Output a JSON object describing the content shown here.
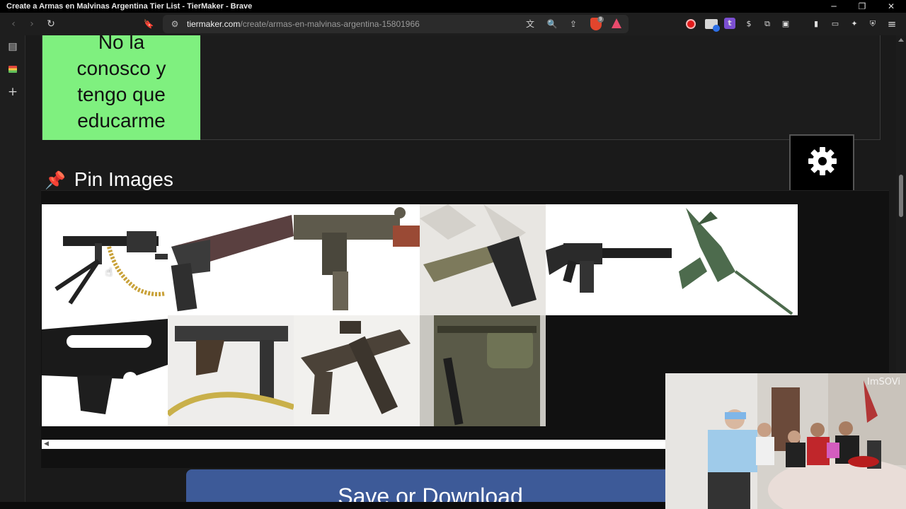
{
  "window": {
    "title": "Create a Armas en Malvinas Argentina Tier List - TierMaker - Brave",
    "controls": {
      "minimize": "─",
      "restore": "❐",
      "close": "✕"
    }
  },
  "toolbar": {
    "back_icon": "‹",
    "forward_icon": "›",
    "reload_icon": "↻",
    "bookmark_icon": "🔖",
    "url_host": "tiermaker.com",
    "url_path": "/create/armas-en-malvinas-argentina-15801966",
    "translate_icon": "文",
    "zoom_icon": "🔍",
    "share_icon": "⇪",
    "brave_badge": "9"
  },
  "extensions": {
    "rec": "record-icon",
    "cam": "camera-extension-icon",
    "t_label": "t",
    "dollar": "$",
    "puzzle": "⧉",
    "tab": "▣",
    "sidebar_toggle": "▮",
    "wallet": "▭",
    "leo": "✦",
    "vpn": "⛨",
    "menu": "≡"
  },
  "sidebar": {
    "panel_icon": "▤",
    "add_icon": "+"
  },
  "tier": {
    "label_lines": [
      "No la",
      "conosco y",
      "tengo que",
      "educarme"
    ],
    "label_color": "#7ff07f"
  },
  "pin_images": {
    "icon": "📌",
    "title": "Pin Images",
    "items": [
      "machine-gun-image",
      "battle-rifle-image",
      "uzi-smg-image",
      "pistol-image",
      "m16-rifle-image",
      "green-smg-image",
      "shotgun-image",
      "fmk-smg-image",
      "grease-gun-image",
      "soldier-with-rifle-image"
    ]
  },
  "scroll_arrow": "◀",
  "save_button": {
    "label": "Save or Download",
    "color": "#3d5a98"
  },
  "webcam": {
    "watermark": "ImSOVi"
  }
}
